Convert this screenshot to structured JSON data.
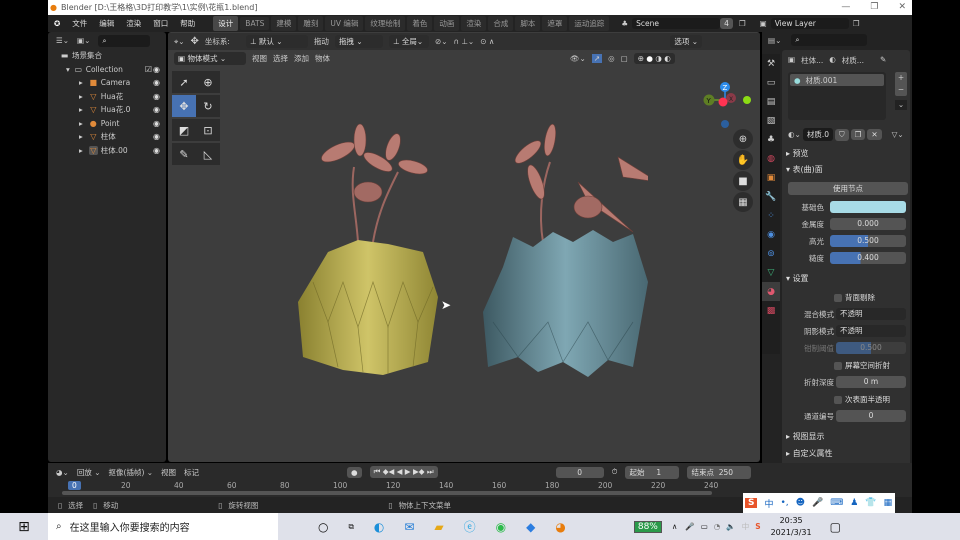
{
  "window": {
    "title": "Blender [D:\\王格格\\3D打印教学\\1\\实例\\花瓶1.blend]",
    "min": "—",
    "max": "❐",
    "close": "✕"
  },
  "menu": [
    "文件",
    "编辑",
    "渲染",
    "窗口",
    "帮助"
  ],
  "workspaces": [
    "设计",
    "BATS",
    "建模",
    "雕刻",
    "UV 编辑",
    "纹理绘制",
    "着色",
    "动画",
    "渲染",
    "合成",
    "脚本",
    "遮罩",
    "运动追踪"
  ],
  "scene": {
    "name": "Scene",
    "count": "4",
    "view_layer": "View Layer"
  },
  "outliner": {
    "root": "场景集合",
    "collection": "Collection",
    "items": [
      "Camera",
      "Hua花",
      "Hua花.0",
      "Point",
      "柱体",
      "柱体.00"
    ]
  },
  "viewport": {
    "coord_label": "坐标系:",
    "coord_value": "默认",
    "drag_label": "拖动",
    "drag_value": "拖拽",
    "pivot": "全局",
    "options": "选项",
    "mode": "物体模式",
    "menus": [
      "视图",
      "选择",
      "添加",
      "物体"
    ],
    "gizmo": {
      "z": "Z",
      "y": "Y",
      "x": "X"
    }
  },
  "properties": {
    "breadcrumb": [
      "柱体...",
      "材质..."
    ],
    "slot": "材质.001",
    "material_name": "材质.0",
    "sections": {
      "preview": "预览",
      "surface": "表(曲)面",
      "settings": "设置",
      "viewport_display": "视图显示",
      "custom_props": "自定义属性"
    },
    "use_nodes": "使用节点",
    "fields": [
      {
        "label": "基础色",
        "value": ""
      },
      {
        "label": "金属度",
        "value": "0.000"
      },
      {
        "label": "高光",
        "value": "0.500",
        "fill": 0.5
      },
      {
        "label": "糙度",
        "value": "0.400",
        "fill": 0.4
      }
    ],
    "backface": "背面剔除",
    "blend_label": "混合模式",
    "blend_value": "不透明",
    "shadow_label": "阴影模式",
    "shadow_value": "不透明",
    "clip_label": "钳制阈值",
    "clip_value": "0.500",
    "clip_fill": 0.5,
    "ssr": "屏幕空间折射",
    "refr_label": "折射深度",
    "refr_value": "0 m",
    "sss": "次表面半透明",
    "pass_label": "通道编号",
    "pass_value": "0",
    "base_color": "#a8dbe6"
  },
  "timeline": {
    "playback": "回放",
    "keying": "抠像(插帧)",
    "view": "视图",
    "marker": "标记",
    "current": "0",
    "start_label": "起始",
    "start": "1",
    "end_label": "结束点",
    "end": "250",
    "ticks": [
      "0",
      "20",
      "40",
      "60",
      "80",
      "100",
      "120",
      "140",
      "160",
      "180",
      "200",
      "220",
      "240"
    ]
  },
  "status": {
    "select": "选择",
    "move": "移动",
    "rotate": "旋转视图",
    "context": "物体上下文菜单"
  },
  "taskbar": {
    "search": "在这里输入你要搜索的内容",
    "battery": "88%",
    "time": "20:35",
    "date": "2021/3/31",
    "ime": "中"
  }
}
